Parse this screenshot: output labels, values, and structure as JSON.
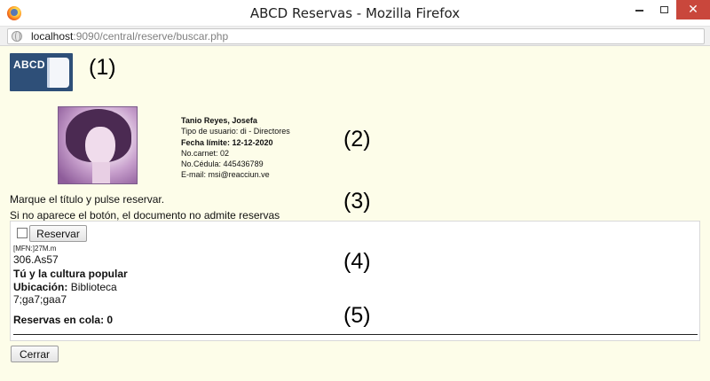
{
  "window": {
    "title": "ABCD Reservas - Mozilla Firefox",
    "close_glyph": "✕"
  },
  "urlbar": {
    "host": "localhost",
    "rest": ":9090/central/reserve/buscar.php"
  },
  "logo": {
    "text": "ABCD"
  },
  "markers": [
    "(1)",
    "(2)",
    "(3)",
    "(4)",
    "(5)"
  ],
  "user": {
    "name": "Tanio Reyes, Josefa",
    "user_type": "Tipo de usuario: di - Directores",
    "due_date": "Fecha límite: 12-12-2020",
    "card_no": "No.carnet: 02",
    "id_no": "No.Cédula: 445436789",
    "email": "E-mail: msi@reacciun.ve"
  },
  "instructions": {
    "line1": "Marque el título y pulse reservar.",
    "line2": "Si no aparece el botón, el documento no admite reservas"
  },
  "record": {
    "reserve_label": "Reservar",
    "mfn": "[MFN:]27M.m",
    "call_number": "306.As57",
    "title": "Tú y la cultura popular",
    "location_label": "Ubicación:",
    "location_value": "Biblioteca",
    "copies": "7;ga7;gaa7",
    "queue_label": "Reservas en cola: 0"
  },
  "footer": {
    "close_label": "Cerrar"
  }
}
